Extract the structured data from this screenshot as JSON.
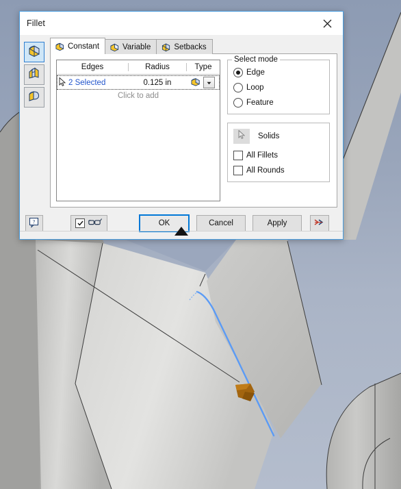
{
  "window": {
    "title": "Fillet",
    "close_icon": "close-icon"
  },
  "side_tools": [
    {
      "name": "edge-fillet-tool",
      "tooltip": "Edge Fillet",
      "active": true
    },
    {
      "name": "face-fillet-tool",
      "tooltip": "Face Fillet",
      "active": false
    },
    {
      "name": "full-round-fillet-tool",
      "tooltip": "Full Round Fillet",
      "active": false
    }
  ],
  "tabs": [
    {
      "label": "Constant",
      "icon": "constant-fillet-icon",
      "active": true
    },
    {
      "label": "Variable",
      "icon": "variable-fillet-icon",
      "active": false
    },
    {
      "label": "Setbacks",
      "icon": "setbacks-fillet-icon",
      "active": false
    }
  ],
  "edges_table": {
    "headers": {
      "edges": "Edges",
      "radius": "Radius",
      "type": "Type"
    },
    "rows": [
      {
        "edges": "2 Selected",
        "radius": "0.125 in",
        "type_icon": "fillet-type-icon"
      }
    ],
    "add_row_label": "Click to add",
    "link_color": "#2255cc",
    "cursor_icon": "cursor-arrow-icon",
    "dropdown_icon": "chevron-down-icon"
  },
  "select_mode": {
    "title": "Select mode",
    "options": [
      {
        "label": "Edge",
        "checked": true
      },
      {
        "label": "Loop",
        "checked": false
      },
      {
        "label": "Feature",
        "checked": false
      }
    ]
  },
  "solids_group": {
    "solids_button_icon": "select-solids-icon",
    "solids_label": "Solids",
    "checkboxes": [
      {
        "label": "All Fillets",
        "checked": false
      },
      {
        "label": "All Rounds",
        "checked": false
      }
    ]
  },
  "footer": {
    "help_label": "?",
    "preview_checkbox_checked": true,
    "preview_icon": "glasses-icon",
    "ok_label": "OK",
    "cancel_label": "Cancel",
    "apply_label": "Apply",
    "more_label": ">>",
    "resize_grip_icon": "resize-grip-triangle-icon"
  },
  "viewport": {
    "background_top_color": "#8d9bb3",
    "background_bottom_color": "#b4bdcd",
    "model_face_color": "#c9c9c7",
    "selected_edge_color": "#5599f5",
    "cursor_marker_color": "#a06010"
  }
}
